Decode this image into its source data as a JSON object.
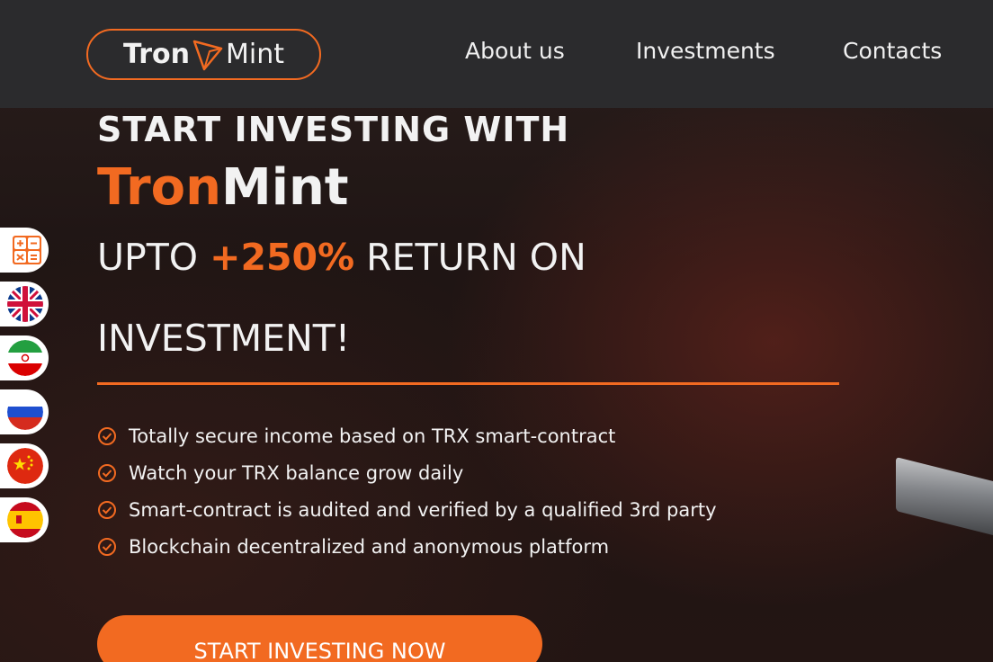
{
  "header": {
    "logo_left": "Tron",
    "logo_right": "Mint",
    "nav": [
      "About us",
      "Investments",
      "Contacts"
    ]
  },
  "hero": {
    "line1": "START INVESTING WITH",
    "brand_part1": "Tron",
    "brand_part2": "Mint",
    "return_prefix": "UPTO ",
    "return_pct": "+250%",
    "return_suffix": " RETURN ON",
    "line4": "INVESTMENT!",
    "features": [
      "Totally secure income based on TRX smart-contract",
      "Watch your TRX balance grow daily",
      "Smart-contract is audited and verified by a qualified 3rd party",
      "Blockchain decentralized and anonymous platform"
    ],
    "cta": "START INVESTING NOW"
  },
  "side_rail": [
    "calculator-icon",
    "flag-uk-icon",
    "flag-iran-icon",
    "flag-russia-icon",
    "flag-china-icon",
    "flag-spain-icon"
  ],
  "colors": {
    "accent": "#f26a21",
    "header_bg": "#2b2b2d",
    "text": "#f2f2f2"
  }
}
